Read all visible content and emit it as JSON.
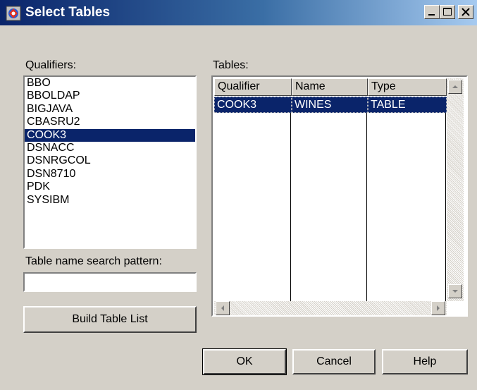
{
  "window": {
    "title": "Select Tables",
    "icon": "app-icon",
    "controls": [
      "minimize-icon",
      "maximize-icon",
      "close-icon"
    ]
  },
  "qualifiers": {
    "label": "Qualifiers:",
    "items": [
      "BBO",
      "BBOLDAP",
      "BIGJAVA",
      "CBASRU2",
      "COOK3",
      "DSNACC",
      "DSNRGCOL",
      "DSN8710",
      "PDK",
      "SYSIBM"
    ],
    "selected": "COOK3"
  },
  "search": {
    "label": "Table name search pattern:",
    "value": ""
  },
  "build_button": "Build Table List",
  "tables": {
    "label": "Tables:",
    "columns": [
      "Qualifier",
      "Name",
      "Type"
    ],
    "rows": [
      [
        "COOK3",
        "WINES",
        "TABLE"
      ]
    ]
  },
  "buttons": {
    "ok": "OK",
    "cancel": "Cancel",
    "help": "Help"
  },
  "colors": {
    "selection": "#0a246a",
    "dialog_bg": "#d4d0c8"
  }
}
